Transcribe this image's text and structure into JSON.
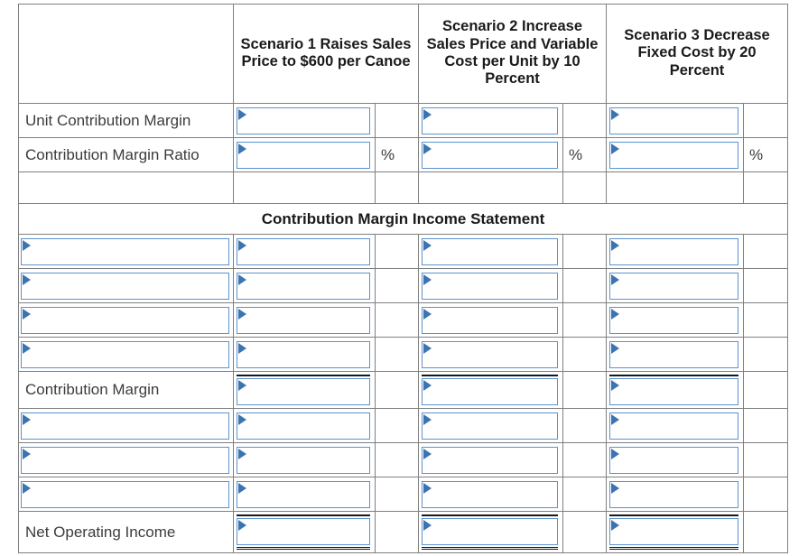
{
  "worksheet": {
    "columns": [
      {
        "id": "label",
        "header": ""
      },
      {
        "id": "scenario1",
        "header": "Scenario 1 Raises Sales Price to $600 per Canoe"
      },
      {
        "id": "scenario2",
        "header": "Scenario 2 Increase Sales Price and Variable Cost per Unit by 10 Percent"
      },
      {
        "id": "scenario3",
        "header": "Scenario 3 Decrease Fixed Cost by 20 Percent"
      }
    ],
    "percent_symbol": "%",
    "top_rows": [
      {
        "label": "Unit Contribution Margin",
        "has_percent": false,
        "values": [
          "",
          "",
          ""
        ]
      },
      {
        "label": "Contribution Margin Ratio",
        "has_percent": true,
        "values": [
          "",
          "",
          ""
        ]
      }
    ],
    "section_banner": "Contribution Margin Income Statement",
    "statement_rows": [
      {
        "label": "",
        "label_is_input": true,
        "values": [
          "",
          "",
          ""
        ],
        "rule": "none"
      },
      {
        "label": "",
        "label_is_input": true,
        "values": [
          "",
          "",
          ""
        ],
        "rule": "none"
      },
      {
        "label": "",
        "label_is_input": true,
        "values": [
          "",
          "",
          ""
        ],
        "rule": "none"
      },
      {
        "label": "",
        "label_is_input": true,
        "values": [
          "",
          "",
          ""
        ],
        "rule": "none"
      },
      {
        "label": "Contribution Margin",
        "label_is_input": false,
        "values": [
          "",
          "",
          ""
        ],
        "rule": "top"
      },
      {
        "label": "",
        "label_is_input": true,
        "values": [
          "",
          "",
          ""
        ],
        "rule": "none"
      },
      {
        "label": "",
        "label_is_input": true,
        "values": [
          "",
          "",
          ""
        ],
        "rule": "none"
      },
      {
        "label": "",
        "label_is_input": true,
        "values": [
          "",
          "",
          ""
        ],
        "rule": "none"
      },
      {
        "label": "Net Operating Income",
        "label_is_input": false,
        "values": [
          "",
          "",
          ""
        ],
        "rule": "both"
      }
    ],
    "colors": {
      "header_blue": "#73ABE5",
      "input_border": "#5B93CE",
      "grid_line": "#7f7f7f",
      "text": "#3c3c3c"
    }
  }
}
